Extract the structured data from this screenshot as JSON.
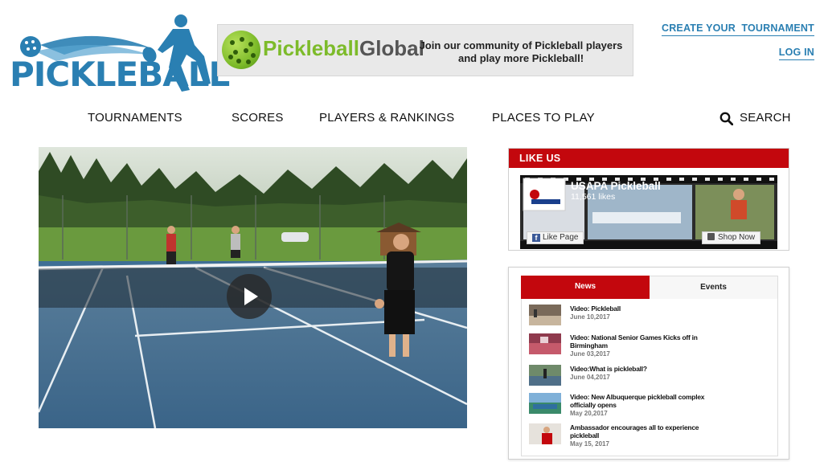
{
  "header": {
    "logo_text": "PICKLEBALL",
    "banner": {
      "brand_part1": "Pickleball",
      "brand_part2": "Global",
      "tagline_line1": "Join our community of Pickleball players",
      "tagline_line2": "and play more Pickleball!"
    },
    "links": {
      "create_tournament": "CREATE YOUR  TOURNAMENT",
      "login": "LOG IN"
    }
  },
  "nav": {
    "items": [
      "TOURNAMENTS",
      "SCORES",
      "PLAYERS & RANKINGS",
      "PLACES TO PLAY"
    ],
    "search_label": "SEARCH"
  },
  "like_us": {
    "heading": "LIKE US",
    "page_name": "USAPA Pickleball",
    "likes": "11,561 likes",
    "like_button": "Like Page",
    "shop_button": "Shop Now"
  },
  "news": {
    "tabs": [
      "News",
      "Events"
    ],
    "items": [
      {
        "title": "Video: Pickleball",
        "date": "June 10,2017"
      },
      {
        "title": "Video: National Senior Games Kicks off in Birmingham",
        "date": "June 03,2017"
      },
      {
        "title": "Video:What is pickleball?",
        "date": "June 04,2017"
      },
      {
        "title": "Video: New Albuquerque pickleball complex officially opens",
        "date": "May 20,2017"
      },
      {
        "title": "Ambassador encourages all to experience pickleball",
        "date": "May 15, 2017"
      }
    ]
  },
  "colors": {
    "brand_blue": "#2a7fb2",
    "accent_red": "#c3070d"
  }
}
